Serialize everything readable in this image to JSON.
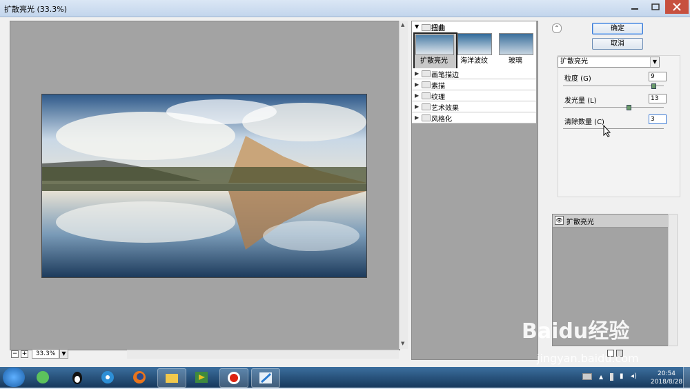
{
  "window": {
    "title": "扩散亮光 (33.3%)"
  },
  "preview": {
    "zoom": "33.3%",
    "zoom_minus": "−",
    "zoom_plus": "+"
  },
  "gallery": {
    "top_group": "扭曲",
    "thumbnails": [
      {
        "label": "扩散亮光",
        "selected": true
      },
      {
        "label": "海洋波纹",
        "selected": false
      },
      {
        "label": "玻璃",
        "selected": false
      }
    ],
    "groups": [
      "画笔描边",
      "素描",
      "纹理",
      "艺术效果",
      "风格化"
    ]
  },
  "buttons": {
    "ok": "确定",
    "cancel": "取消"
  },
  "filter_select": {
    "value": "扩散亮光"
  },
  "params": [
    {
      "label": "粒度 (G)",
      "value": "9",
      "level": 0.9
    },
    {
      "label": "发光量 (L)",
      "value": "13",
      "level": 0.65
    },
    {
      "label": "清除数量 (C)",
      "value": "3",
      "level": 0.15
    }
  ],
  "layers": {
    "items": [
      {
        "name": "扩散亮光"
      }
    ]
  },
  "taskbar": {
    "time": "20:54",
    "date": "2018/8/28"
  },
  "watermark": {
    "line1": "Baidu经验",
    "line2": "jingyan.baidu.com"
  },
  "colors": {
    "taskbar": "#1f4a74",
    "preview_bg": "#a3a3a3",
    "accent": "#3d7bd6"
  }
}
